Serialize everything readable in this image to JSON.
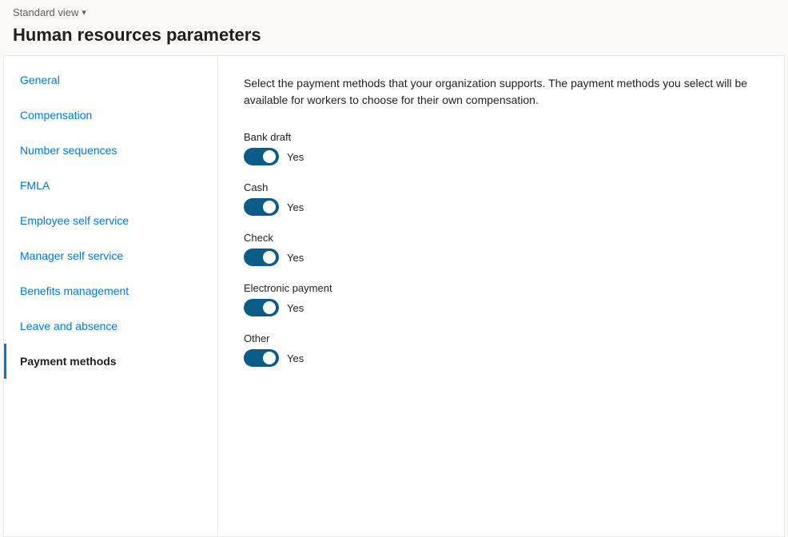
{
  "topbar": {
    "view_label": "Standard view",
    "chevron": "▾"
  },
  "page": {
    "title": "Human resources parameters"
  },
  "sidebar": {
    "items": [
      {
        "id": "general",
        "label": "General",
        "active": false
      },
      {
        "id": "compensation",
        "label": "Compensation",
        "active": false
      },
      {
        "id": "number-sequences",
        "label": "Number sequences",
        "active": false
      },
      {
        "id": "fmla",
        "label": "FMLA",
        "active": false
      },
      {
        "id": "employee-self-service",
        "label": "Employee self service",
        "active": false
      },
      {
        "id": "manager-self-service",
        "label": "Manager self service",
        "active": false
      },
      {
        "id": "benefits-management",
        "label": "Benefits management",
        "active": false
      },
      {
        "id": "leave-and-absence",
        "label": "Leave and absence",
        "active": false
      },
      {
        "id": "payment-methods",
        "label": "Payment methods",
        "active": true
      }
    ]
  },
  "main": {
    "description": "Select the payment methods that your organization supports. The payment methods you select will be available for workers to choose for their own compensation.",
    "payment_methods": [
      {
        "id": "bank-draft",
        "label": "Bank draft",
        "enabled": true,
        "value_label": "Yes"
      },
      {
        "id": "cash",
        "label": "Cash",
        "enabled": true,
        "value_label": "Yes"
      },
      {
        "id": "check",
        "label": "Check",
        "enabled": true,
        "value_label": "Yes"
      },
      {
        "id": "electronic-payment",
        "label": "Electronic payment",
        "enabled": true,
        "value_label": "Yes"
      },
      {
        "id": "other",
        "label": "Other",
        "enabled": true,
        "value_label": "Yes"
      }
    ]
  }
}
